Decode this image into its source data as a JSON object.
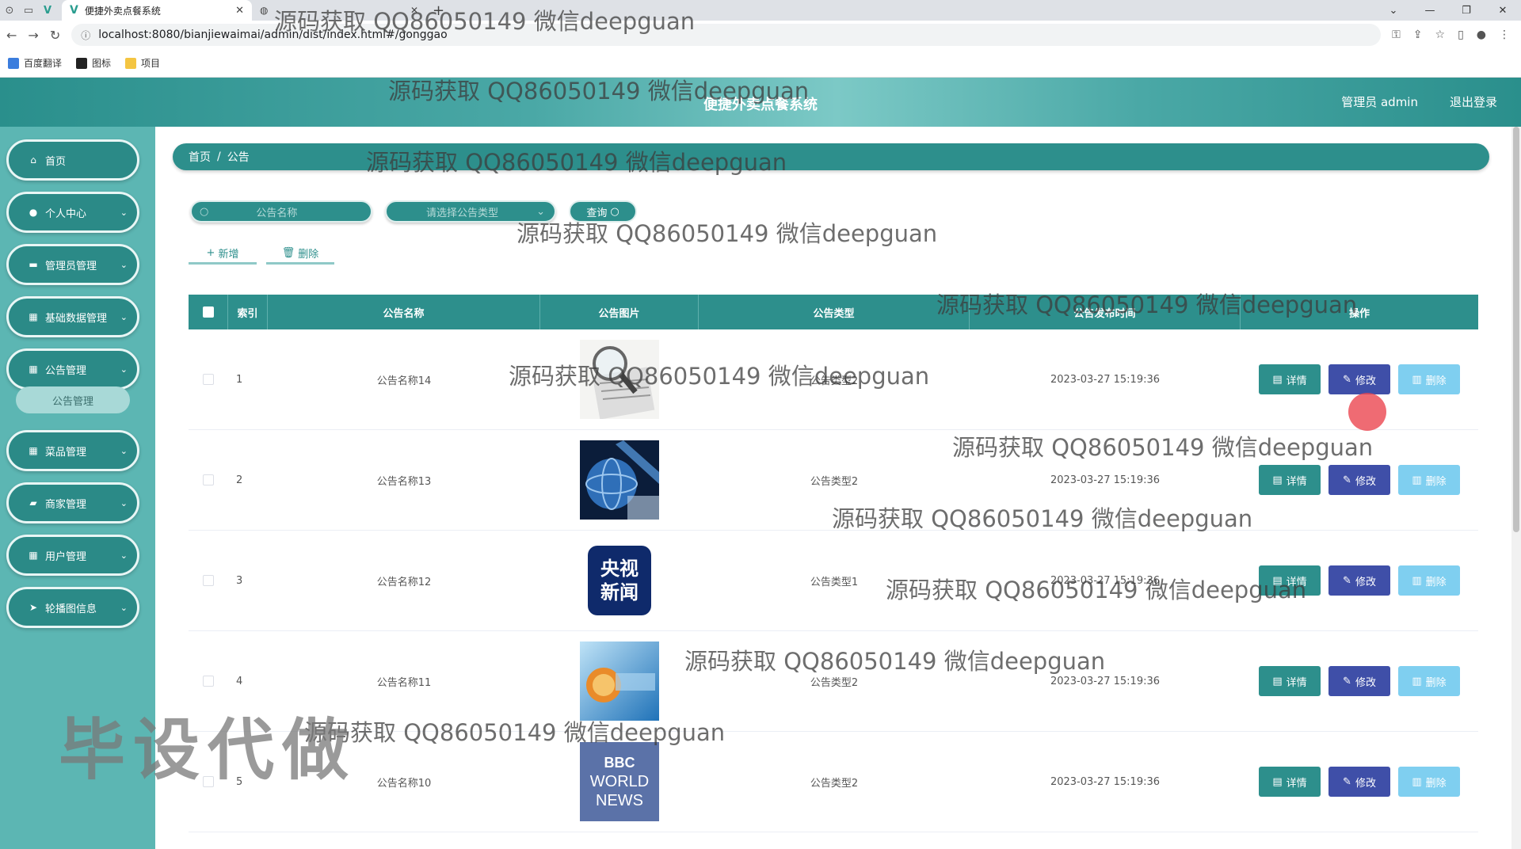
{
  "browser": {
    "tab_title": "便捷外卖点餐系统",
    "tab2_title": "",
    "url": "localhost:8080/bianjiewaimai/admin/dist/index.html#/gonggao",
    "bookmarks": [
      "百度翻译",
      "图标",
      "项目"
    ]
  },
  "header": {
    "title": "便捷外卖点餐系统",
    "user": "管理员 admin",
    "logout": "退出登录"
  },
  "sidebar": {
    "items": [
      {
        "label": "首页",
        "icon": "home-icon"
      },
      {
        "label": "个人中心",
        "icon": "user-icon"
      },
      {
        "label": "管理员管理",
        "icon": "doc-icon"
      },
      {
        "label": "基础数据管理",
        "icon": "grid-icon"
      },
      {
        "label": "公告管理",
        "icon": "grid-icon"
      },
      {
        "label": "菜品管理",
        "icon": "grid-icon"
      },
      {
        "label": "商家管理",
        "icon": "chat-icon"
      },
      {
        "label": "用户管理",
        "icon": "grid-icon"
      },
      {
        "label": "轮播图信息",
        "icon": "send-icon"
      }
    ],
    "submenu": "公告管理"
  },
  "breadcrumb": {
    "home": "首页",
    "sep": "/",
    "current": "公告"
  },
  "search": {
    "name_placeholder": "公告名称",
    "type_placeholder": "请选择公告类型",
    "query_label": "查询"
  },
  "actions": {
    "add_label": "新增",
    "delete_label": "删除"
  },
  "table": {
    "headers": {
      "index": "索引",
      "name": "公告名称",
      "image": "公告图片",
      "type": "公告类型",
      "time": "公告发布时间",
      "ops": "操作"
    },
    "rows": [
      {
        "idx": "1",
        "name": "公告名称14",
        "image": "news-magnifier",
        "type": "公告类型2",
        "time": "2023-03-27 15:19:36"
      },
      {
        "idx": "2",
        "name": "公告名称13",
        "image": "globe-news",
        "type": "公告类型2",
        "time": "2023-03-27 15:19:36"
      },
      {
        "idx": "3",
        "name": "公告名称12",
        "image": "cctv-news",
        "type": "公告类型1",
        "time": "2023-03-27 15:19:36"
      },
      {
        "idx": "4",
        "name": "公告名称11",
        "image": "blue-news",
        "type": "公告类型2",
        "time": "2023-03-27 15:19:36"
      },
      {
        "idx": "5",
        "name": "公告名称10",
        "image": "bbc-world-news",
        "type": "公告类型2",
        "time": "2023-03-27 15:19:36"
      }
    ],
    "detail_label": "详情",
    "edit_label": "修改",
    "delete_label": "删除"
  },
  "images": {
    "cctv_line1": "央视",
    "cctv_line2": "新闻",
    "bbc_line1": "BBC",
    "bbc_line2": "WORLD",
    "bbc_line3": "NEWS"
  },
  "watermarks": {
    "text": "源码获取 QQ86050149 微信deepguan",
    "big": "毕设代做"
  },
  "colors": {
    "primary": "#2d8f8c",
    "edit": "#3f4fa8",
    "delete": "#7fcff0",
    "sidebar": "#5cb6b3"
  }
}
